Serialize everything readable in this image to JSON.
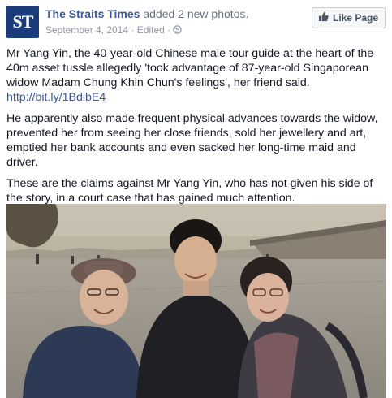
{
  "post": {
    "page_name": "The Straits Times",
    "action_text": "added 2 new photos.",
    "date": "September 4, 2014",
    "edited": "Edited",
    "separator": "·",
    "like_page_label": "Like Page",
    "logo_text": "ST",
    "paragraph1": "Mr Yang Yin, the 40-year-old Chinese male tour guide at the heart of the 40m asset tussle allegedly 'took advantage of 87-year-old Singaporean widow Madam Chung Khin Chun's feelings', her friend said.",
    "link": "http://bit.ly/1BdibE4",
    "paragraph2": "He apparently also made frequent physical advances towards the widow, prevented her from seeing her close friends, sold her jewellery and art, emptied her bank accounts and even sacked her long-time maid and driver.",
    "paragraph3": "These are the claims against Mr Yang Yin, who has not given his side of the story, in a court case that has gained much attention."
  },
  "colors": {
    "brand_blue": "#3b5998",
    "logo_bg": "#1b3c7a",
    "meta_gray": "#9197a3"
  },
  "icons": {
    "globe": "globe-icon",
    "like": "thumbs-up-icon"
  }
}
